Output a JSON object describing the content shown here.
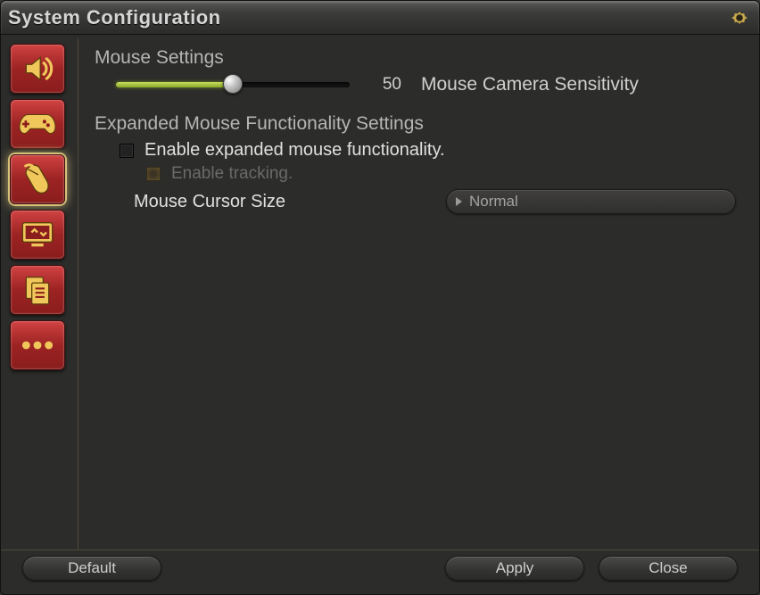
{
  "window": {
    "title": "System Configuration"
  },
  "sidebar": {
    "items": [
      {
        "name": "sound"
      },
      {
        "name": "gamepad"
      },
      {
        "name": "mouse"
      },
      {
        "name": "display-hud"
      },
      {
        "name": "clipboard"
      },
      {
        "name": "other"
      }
    ],
    "activeIndex": 2
  },
  "panel": {
    "mouse_settings_label": "Mouse Settings",
    "sensitivity": {
      "value": "50",
      "percent": "50",
      "label": "Mouse Camera Sensitivity"
    },
    "expanded_label": "Expanded Mouse Functionality Settings",
    "expanded_checkbox_label": "Enable expanded mouse functionality.",
    "tracking_checkbox_label": "Enable tracking.",
    "cursor_size_label": "Mouse Cursor Size",
    "cursor_size_value": "Normal"
  },
  "footer": {
    "default_label": "Default",
    "apply_label": "Apply",
    "close_label": "Close"
  }
}
